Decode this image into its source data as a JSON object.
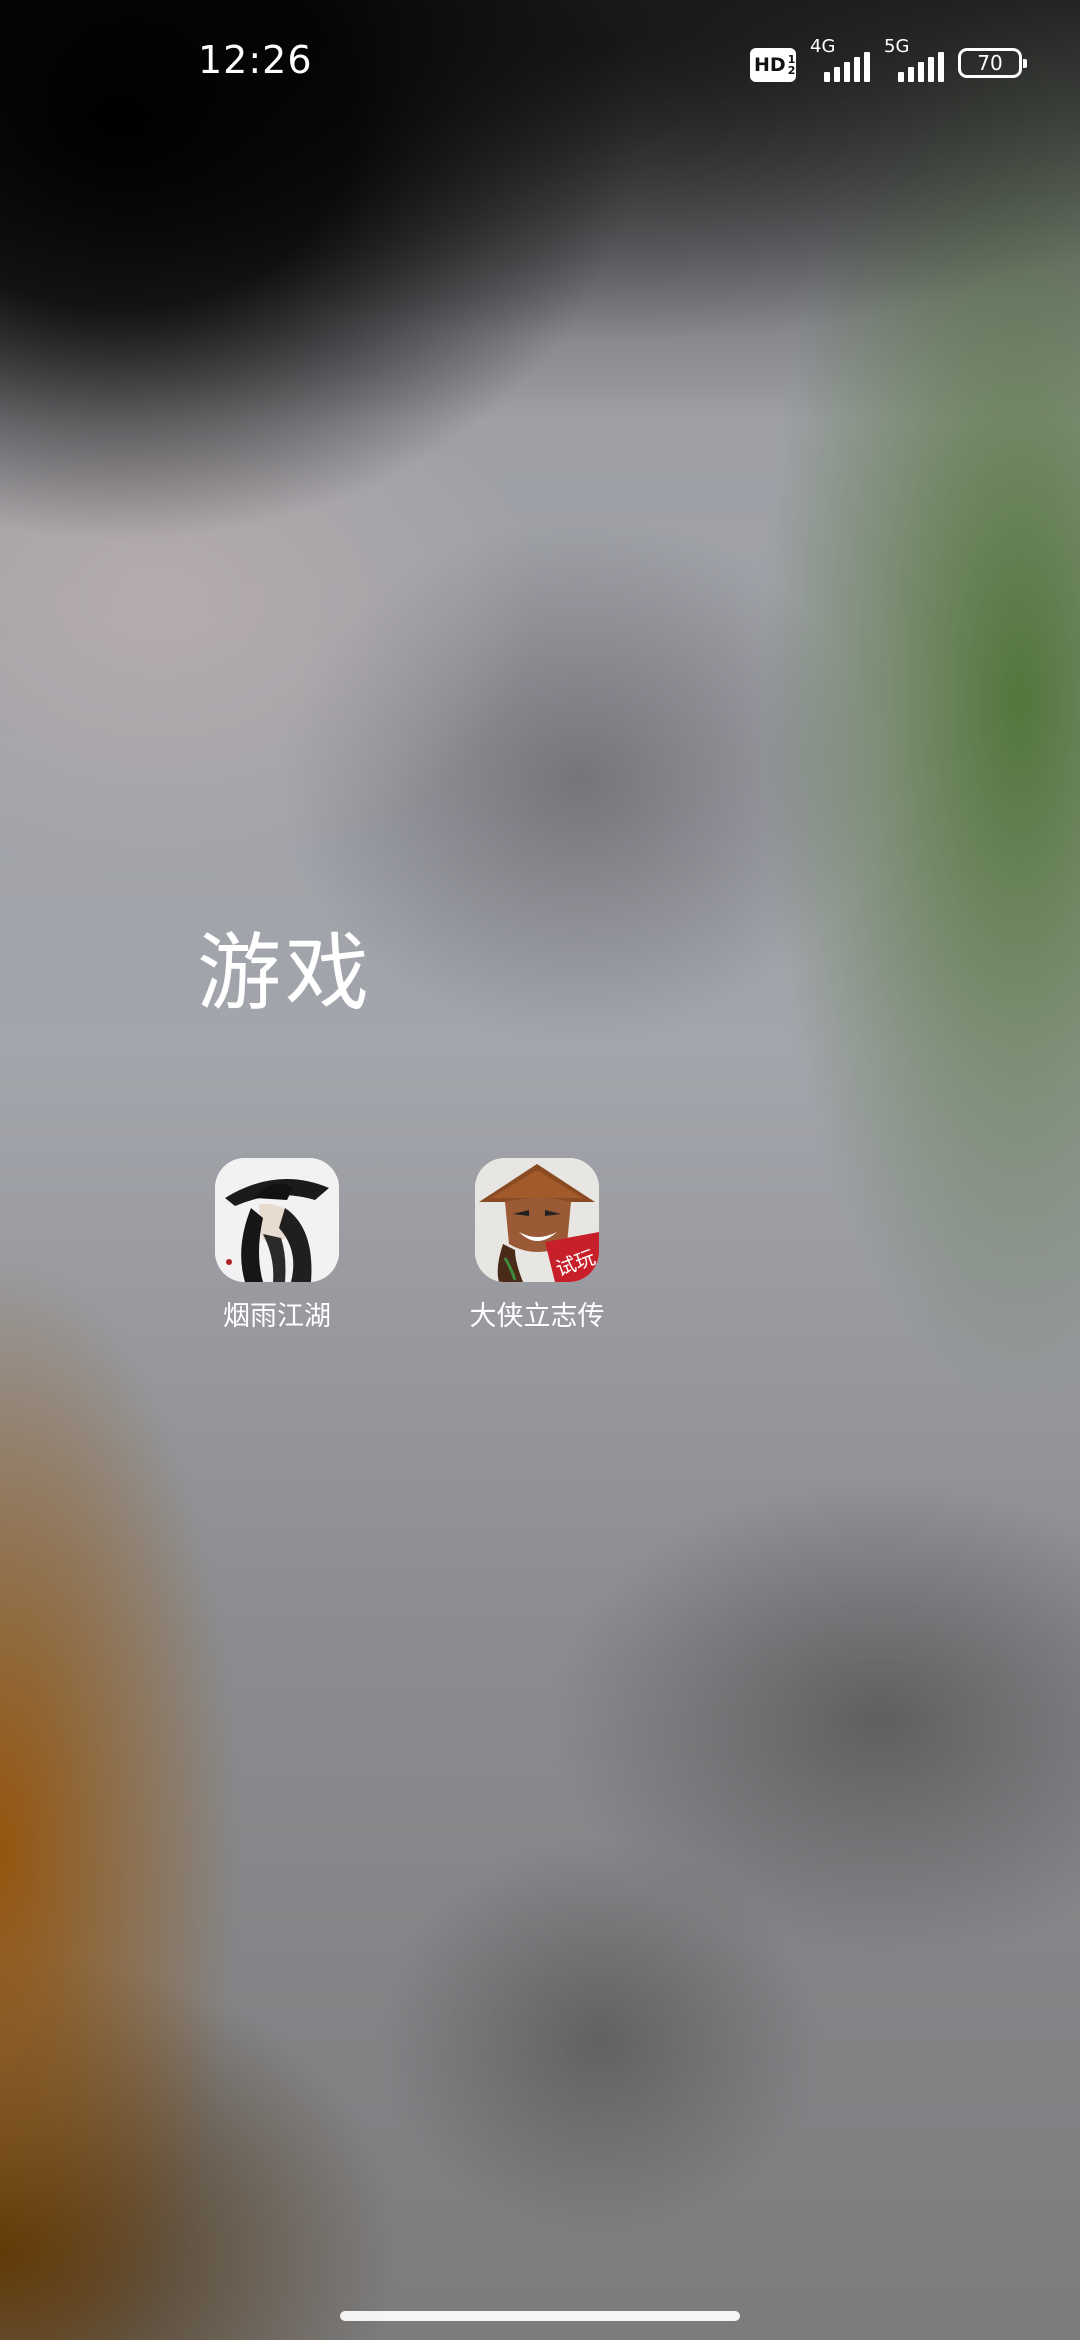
{
  "status_bar": {
    "time": "12:26",
    "hd_label": "HD",
    "hd_sub_1": "1",
    "hd_sub_2": "2",
    "net1_label": "4G",
    "net2_label": "5G",
    "battery_level": "70",
    "signal_1_bars": 5,
    "signal_2_bars": 5
  },
  "folder": {
    "title": "游戏",
    "apps": [
      {
        "label": "烟雨江湖",
        "icon": "swordsman-hat-icon"
      },
      {
        "label": "大侠立志传",
        "icon": "hero-strawhat-icon",
        "badge": "试玩"
      }
    ]
  },
  "colors": {
    "text": "#ffffff",
    "badge_red": "#c8202a",
    "hat_brown": "#8a4a22"
  }
}
